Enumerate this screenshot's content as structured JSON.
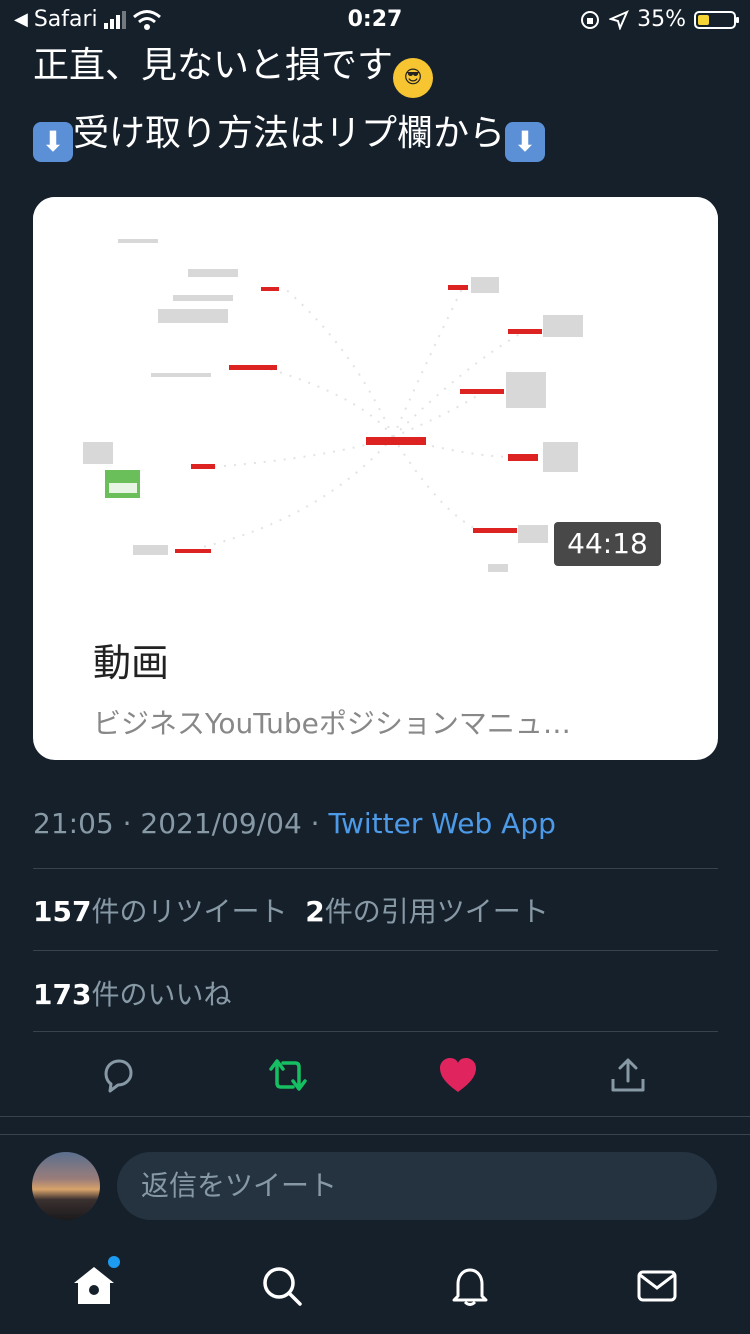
{
  "status_bar": {
    "back_app": "Safari",
    "time": "0:27",
    "battery": "35%"
  },
  "tweet": {
    "line1": "正直、見ないと損です",
    "line2": "受け取り方法はリプ欄から",
    "card": {
      "duration": "44:18",
      "title": "動画",
      "subtitle": "ビジネスYouTubeポジションマニュ…"
    },
    "meta": {
      "timestamp": "21:05 · 2021/09/04 · ",
      "source": "Twitter Web App"
    },
    "stats": {
      "retweet_count": "157",
      "retweet_label": "件のリツイート",
      "quote_count": "2",
      "quote_label": "件の引用ツイート",
      "like_count": "173",
      "like_label": "件のいいね"
    }
  },
  "reply": {
    "placeholder": "返信をツイート"
  },
  "icons": {
    "reply": "reply-icon",
    "retweet": "retweet-icon",
    "like": "heart-icon",
    "share": "share-icon",
    "home": "home-icon",
    "search": "search-icon",
    "notifications": "bell-icon",
    "messages": "mail-icon"
  },
  "colors": {
    "background": "#15202b",
    "accent": "#4c9ae8",
    "retweet_active": "#17bf63",
    "like_active": "#e0245e"
  }
}
